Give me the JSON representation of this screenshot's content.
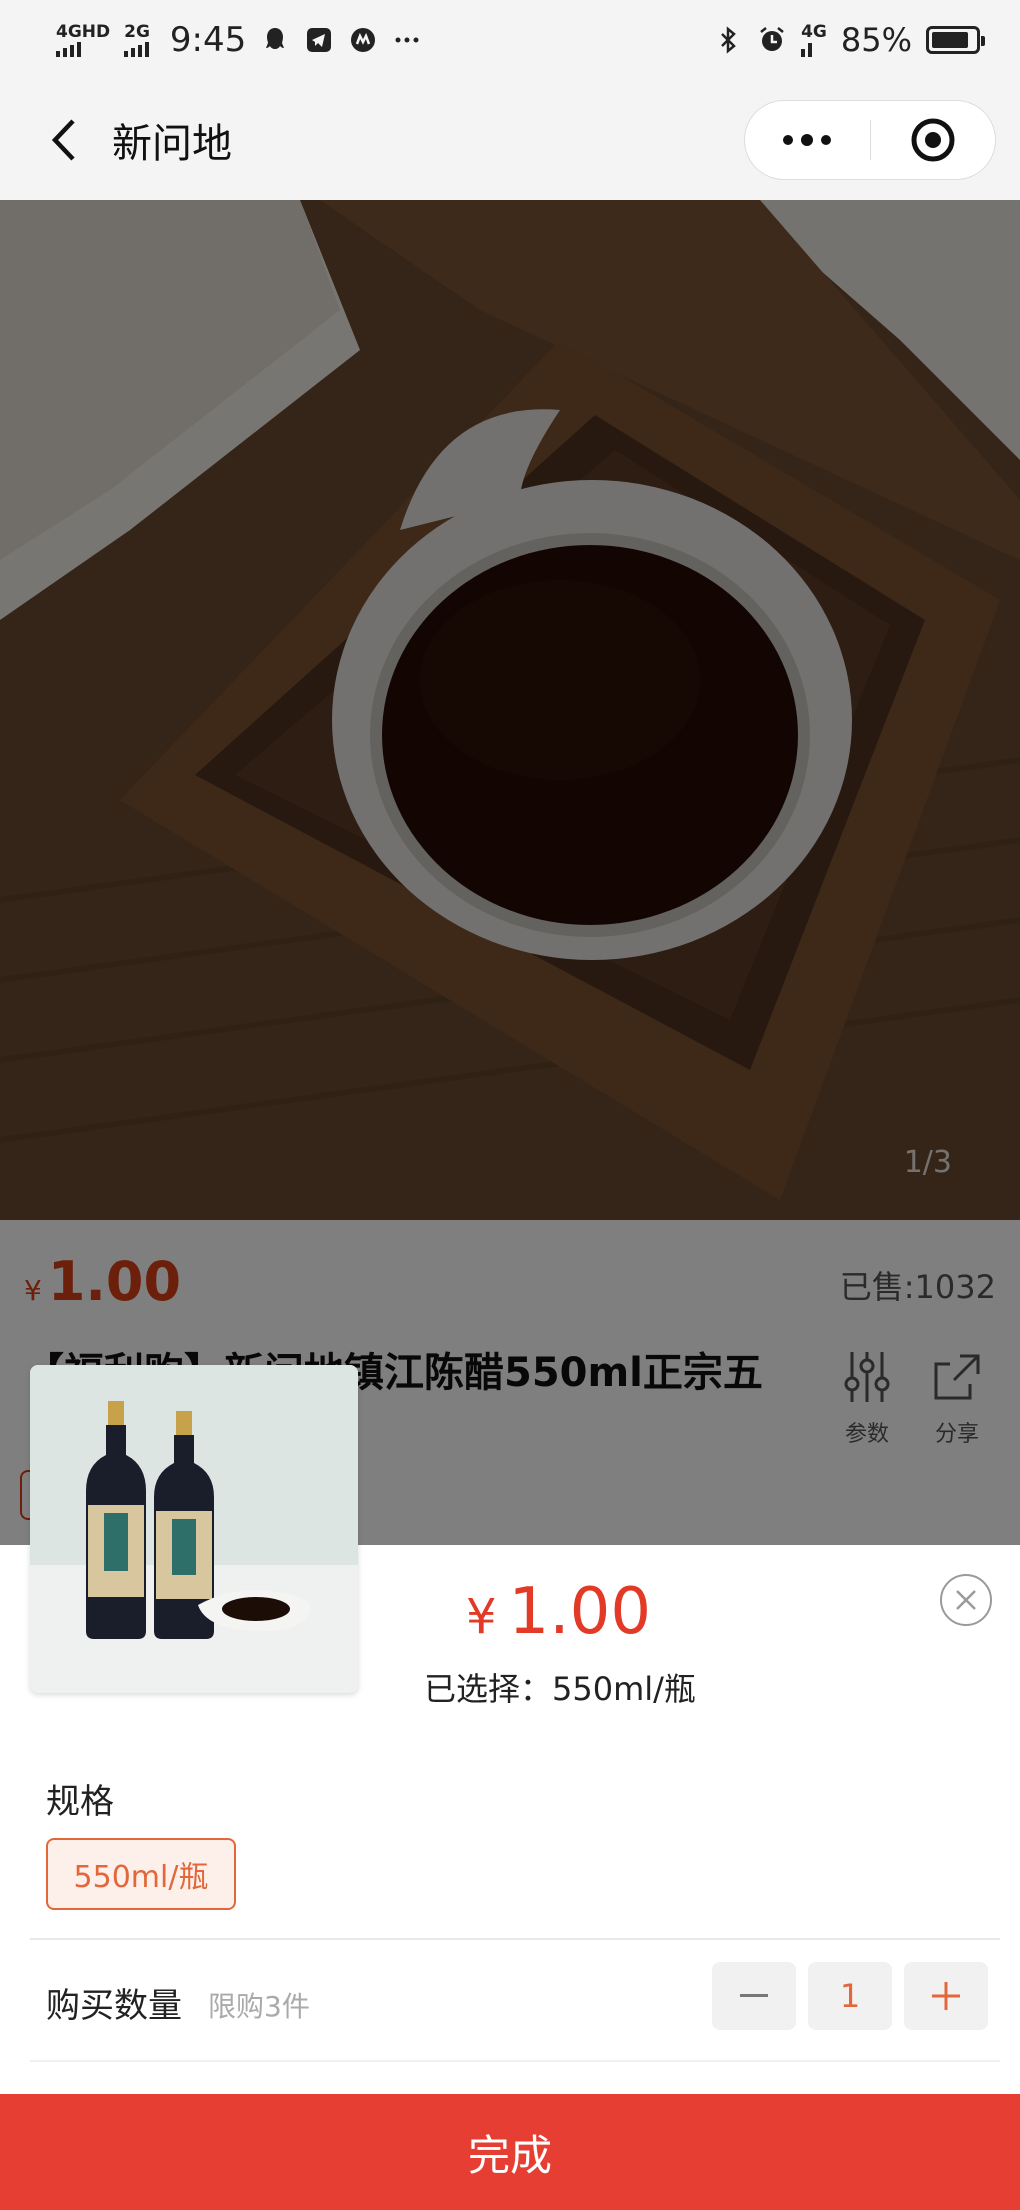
{
  "status_bar": {
    "network_1": "4GHD",
    "network_2": "2G",
    "time": "9:45",
    "network_3": "4G",
    "battery": "85%",
    "battery_level": 0.85,
    "icons": [
      "qq-icon",
      "telegram-icon",
      "app-icon",
      "more-dots-icon",
      "bluetooth-icon",
      "alarm-icon"
    ]
  },
  "nav": {
    "title": "新问地",
    "back_icon": "chevron-left-icon",
    "menu_icon": "more-dots-icon",
    "close_icon": "target-icon"
  },
  "hero": {
    "counter": "1/3"
  },
  "product": {
    "currency": "¥",
    "price": "1.00",
    "sold": "已售:1032",
    "title": "【福利购】新问地镇江陈醋550ml正宗五",
    "params_label": "参数",
    "share_label": "分享"
  },
  "sheet": {
    "currency": "¥",
    "price": "1.00",
    "selected": "已选择：550ml/瓶",
    "spec_label": "规格",
    "spec_option": "550ml/瓶",
    "qty_label": "购买数量",
    "qty_limit": "限购3件",
    "qty_value": "1",
    "minus": "−",
    "plus": "+",
    "confirm": "完成"
  },
  "colors": {
    "accent": "#e23a27",
    "spec_accent": "#e2683b",
    "confirm_bg": "#e63e33"
  }
}
